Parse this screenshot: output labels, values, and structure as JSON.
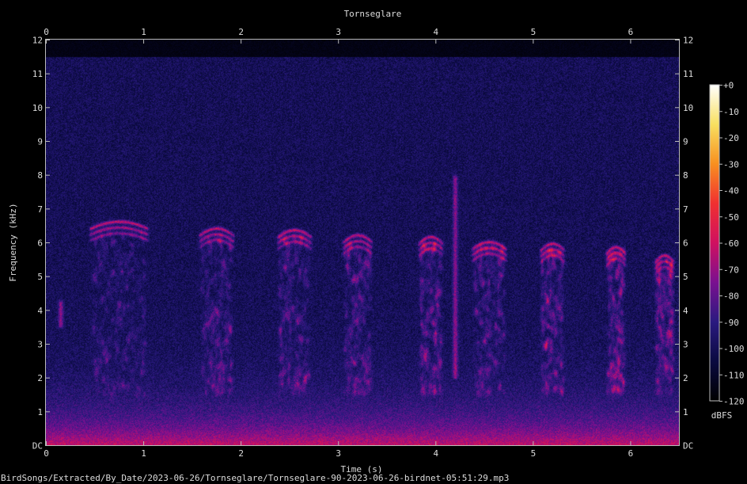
{
  "chart_data": {
    "type": "heatmap",
    "title": "Tornseglare",
    "xlabel": "Time (s)",
    "ylabel": "Frequency (kHz)",
    "x_range": [
      0,
      6.5
    ],
    "y_range": [
      0,
      12
    ],
    "x_ticks": [
      "0",
      "1",
      "2",
      "3",
      "4",
      "5",
      "6"
    ],
    "y_ticks": [
      "DC",
      "1",
      "2",
      "3",
      "4",
      "5",
      "6",
      "7",
      "8",
      "9",
      "10",
      "11",
      "12"
    ],
    "colorbar": {
      "label": "dBFS",
      "ticks": [
        "+0",
        "-10",
        "-20",
        "-30",
        "-40",
        "-50",
        "-60",
        "-70",
        "-80",
        "-90",
        "-100",
        "-110",
        "-120"
      ],
      "range": [
        -120,
        0
      ],
      "colormap": [
        "#000000",
        "#0a0a40",
        "#2a1a80",
        "#7a1090",
        "#d01060",
        "#f03030",
        "#f89020",
        "#f8e060",
        "#ffffff"
      ]
    },
    "noise_cutoff_khz": 11.5,
    "calls": [
      {
        "t": 0.75,
        "f_high": 6.6,
        "f_low": 6.3,
        "width": 0.6
      },
      {
        "t": 1.75,
        "f_high": 6.4,
        "f_low": 6.2,
        "width": 0.35
      },
      {
        "t": 2.55,
        "f_high": 6.35,
        "f_low": 6.2,
        "width": 0.35
      },
      {
        "t": 3.2,
        "f_high": 6.2,
        "f_low": 6.0,
        "width": 0.3
      },
      {
        "t": 3.95,
        "f_high": 6.15,
        "f_low": 6.0,
        "width": 0.25
      },
      {
        "t": 4.55,
        "f_high": 6.0,
        "f_low": 5.9,
        "width": 0.35
      },
      {
        "t": 5.2,
        "f_high": 5.95,
        "f_low": 5.85,
        "width": 0.25
      },
      {
        "t": 5.85,
        "f_high": 5.85,
        "f_low": 5.8,
        "width": 0.2
      },
      {
        "t": 6.35,
        "f_high": 5.6,
        "f_low": 5.5,
        "width": 0.2
      }
    ],
    "transients": [
      {
        "t": 4.2,
        "f_low": 2.0,
        "f_high": 8.0
      },
      {
        "t": 0.15,
        "f_low": 3.5,
        "f_high": 4.3
      }
    ]
  },
  "footer": "BirdSongs/Extracted/By_Date/2023-06-26/Tornseglare/Tornseglare-90-2023-06-26-birdnet-05:51:29.mp3"
}
